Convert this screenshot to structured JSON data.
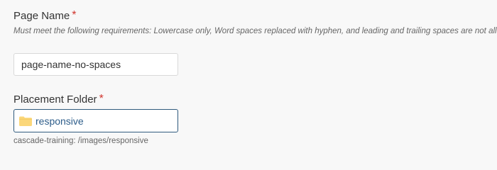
{
  "page_name": {
    "label": "Page Name",
    "required_marker": "*",
    "helper": "Must meet the following requirements: Lowercase only, Word spaces replaced with hyphen, and leading and trailing spaces are not allowed",
    "value": "page-name-no-spaces"
  },
  "placement_folder": {
    "label": "Placement Folder",
    "required_marker": "*",
    "folder_name": "responsive",
    "folder_icon": "folder-icon",
    "path": "cascade-training: /images/responsive"
  },
  "colors": {
    "required": "#d0342c",
    "link": "#2d5d8a",
    "folder": "#fbd77a",
    "focus_border": "#2f5a7d"
  }
}
